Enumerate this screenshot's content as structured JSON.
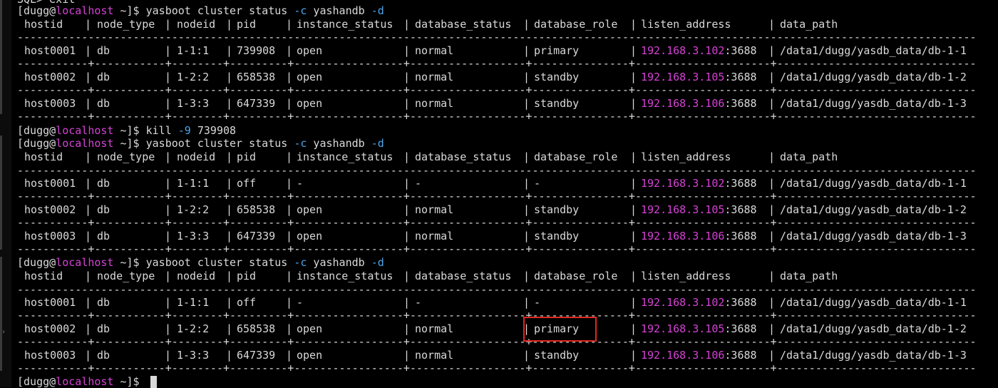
{
  "terminal": {
    "partial_top_line": "SQL> exit",
    "prompt": {
      "user": "dugg",
      "at": "@",
      "host": "localhost",
      "path": " ~]$ "
    },
    "commands": [
      {
        "pre": "yasboot cluster status ",
        "flag1": "-c",
        "mid": " yashandb ",
        "flag2": "-d"
      },
      {
        "pre": "kill ",
        "flag1": "-9",
        "mid": " 739908",
        "flag2": ""
      },
      {
        "pre": "yasboot cluster status ",
        "flag1": "-c",
        "mid": " yashandb ",
        "flag2": "-d"
      },
      {
        "pre": "yasboot cluster status ",
        "flag1": "-c",
        "mid": " yashandb ",
        "flag2": "-d"
      }
    ],
    "headers": [
      "hostid",
      "node_type",
      "nodeid",
      "pid",
      "instance_status",
      "database_status",
      "database_role",
      "listen_address",
      "data_path"
    ],
    "tables": [
      {
        "rows": [
          {
            "hostid": "host0001",
            "node_type": "db",
            "nodeid": "1-1:1",
            "pid": "739908",
            "instance_status": "open",
            "database_status": "normal",
            "database_role": "primary",
            "ip": "192.168.3.102",
            "port": ":3688",
            "data_path": "/data1/dugg/yasdb_data/db-1-1"
          },
          {
            "hostid": "host0002",
            "node_type": "db",
            "nodeid": "1-2:2",
            "pid": "658538",
            "instance_status": "open",
            "database_status": "normal",
            "database_role": "standby",
            "ip": "192.168.3.105",
            "port": ":3688",
            "data_path": "/data1/dugg/yasdb_data/db-1-2"
          },
          {
            "hostid": "host0003",
            "node_type": "db",
            "nodeid": "1-3:3",
            "pid": "647339",
            "instance_status": "open",
            "database_status": "normal",
            "database_role": "standby",
            "ip": "192.168.3.106",
            "port": ":3688",
            "data_path": "/data1/dugg/yasdb_data/db-1-3"
          }
        ]
      },
      {
        "rows": [
          {
            "hostid": "host0001",
            "node_type": "db",
            "nodeid": "1-1:1",
            "pid": "off",
            "instance_status": "-",
            "database_status": "-",
            "database_role": "-",
            "ip": "192.168.3.102",
            "port": ":3688",
            "data_path": "/data1/dugg/yasdb_data/db-1-1"
          },
          {
            "hostid": "host0002",
            "node_type": "db",
            "nodeid": "1-2:2",
            "pid": "658538",
            "instance_status": "open",
            "database_status": "normal",
            "database_role": "standby",
            "ip": "192.168.3.105",
            "port": ":3688",
            "data_path": "/data1/dugg/yasdb_data/db-1-2"
          },
          {
            "hostid": "host0003",
            "node_type": "db",
            "nodeid": "1-3:3",
            "pid": "647339",
            "instance_status": "open",
            "database_status": "normal",
            "database_role": "standby",
            "ip": "192.168.3.106",
            "port": ":3688",
            "data_path": "/data1/dugg/yasdb_data/db-1-3"
          }
        ]
      },
      {
        "rows": [
          {
            "hostid": "host0001",
            "node_type": "db",
            "nodeid": "1-1:1",
            "pid": "off",
            "instance_status": "-",
            "database_status": "-",
            "database_role": "-",
            "ip": "192.168.3.102",
            "port": ":3688",
            "data_path": "/data1/dugg/yasdb_data/db-1-1"
          },
          {
            "hostid": "host0002",
            "node_type": "db",
            "nodeid": "1-2:2",
            "pid": "658538",
            "instance_status": "open",
            "database_status": "normal",
            "database_role": "primary",
            "ip": "192.168.3.105",
            "port": ":3688",
            "data_path": "/data1/dugg/yasdb_data/db-1-2"
          },
          {
            "hostid": "host0003",
            "node_type": "db",
            "nodeid": "1-3:3",
            "pid": "647339",
            "instance_status": "open",
            "database_status": "normal",
            "database_role": "standby",
            "ip": "192.168.3.106",
            "port": ":3688",
            "data_path": "/data1/dugg/yasdb_data/db-1-3"
          }
        ]
      }
    ],
    "colors": {
      "background": "#000000",
      "text": "#d9d9d9",
      "host_magenta": "#d542d5",
      "flag_blue": "#4fa3e8",
      "highlight_red": "#e0281e"
    },
    "highlight": {
      "table": 2,
      "row": 1,
      "column": "database_role"
    }
  }
}
